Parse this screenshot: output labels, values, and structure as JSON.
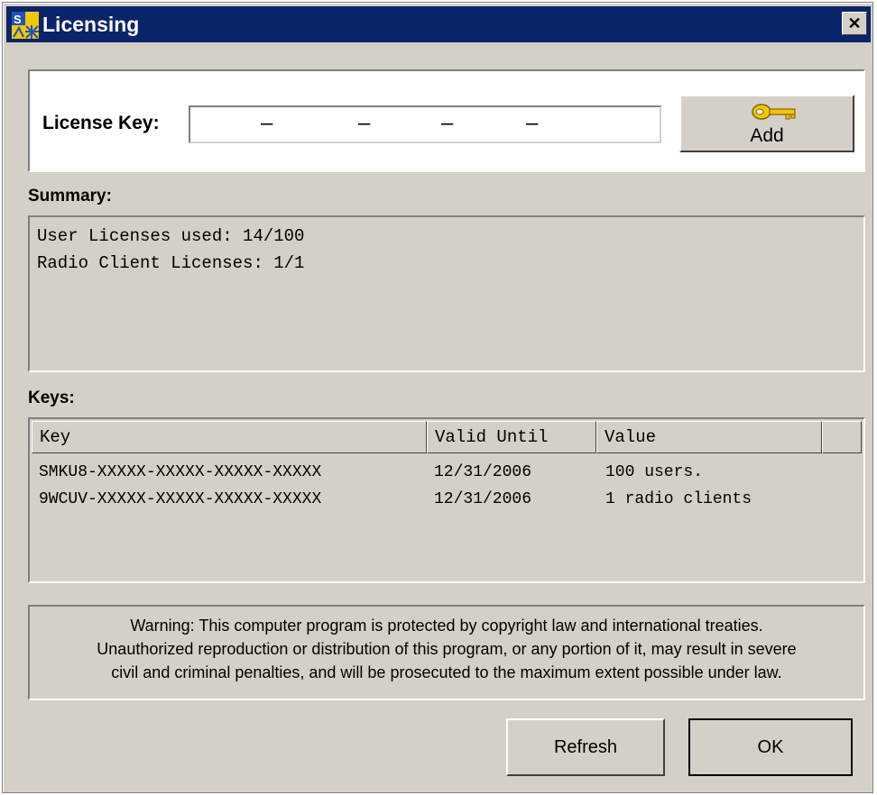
{
  "window": {
    "title": "Licensing",
    "close_label": "✕"
  },
  "license_key": {
    "label": "License Key:",
    "value": "",
    "dashes": [
      "–",
      "–",
      "–",
      "–"
    ],
    "add_label": "Add"
  },
  "summary": {
    "label": "Summary:",
    "lines": [
      "User Licenses used: 14/100",
      "Radio Client Licenses: 1/1"
    ]
  },
  "keys": {
    "label": "Keys:",
    "columns": [
      "Key",
      "Valid Until",
      "Value"
    ],
    "rows": [
      [
        "SMKU8-XXXXX-XXXXX-XXXXX-XXXXX",
        "12/31/2006",
        "100 users."
      ],
      [
        "9WCUV-XXXXX-XXXXX-XXXXX-XXXXX",
        "12/31/2006",
        "1 radio clients"
      ]
    ]
  },
  "warning": {
    "lines": [
      "Warning: This computer program is protected by copyright law and international treaties.",
      "Unauthorized reproduction or distribution of this program, or any portion of it, may result in severe",
      "civil and criminal penalties, and will be prosecuted to the maximum extent possible under law."
    ]
  },
  "buttons": {
    "refresh": "Refresh",
    "ok": "OK"
  },
  "colors": {
    "titlebar": "#0a246a",
    "face": "#d4d0c8",
    "key_icon": "#f0c800"
  }
}
